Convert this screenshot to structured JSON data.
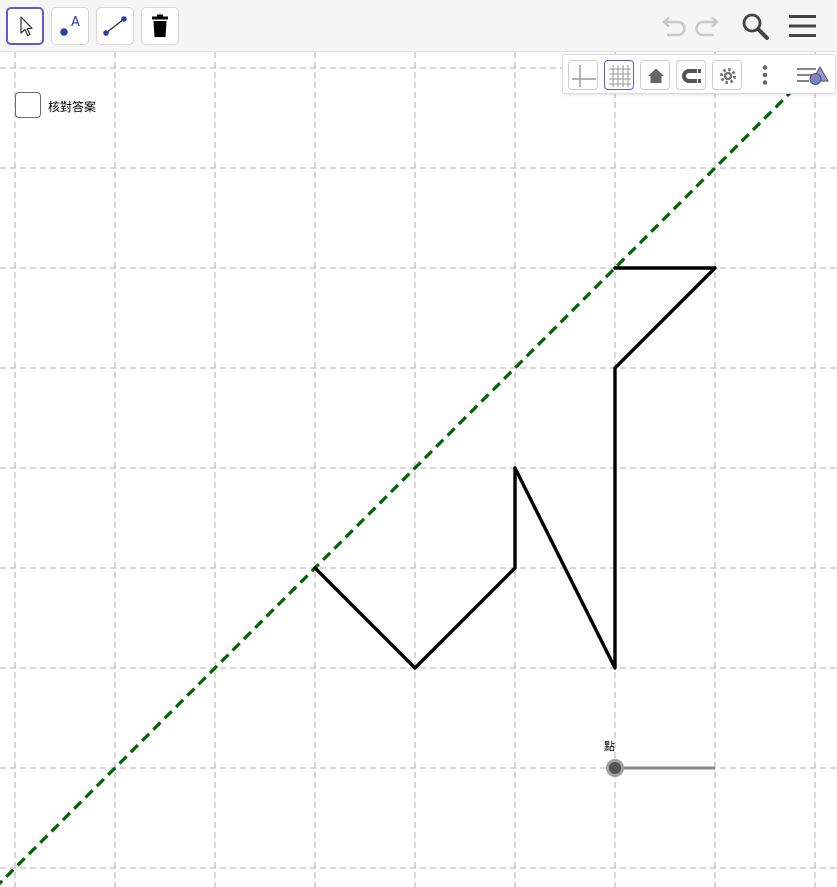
{
  "toolbar": {
    "tools": [
      {
        "name": "move-tool",
        "selected": true
      },
      {
        "name": "point-tool",
        "glyph": "A"
      },
      {
        "name": "segment-tool"
      },
      {
        "name": "delete-tool"
      }
    ],
    "right_controls": [
      "undo-icon",
      "redo-icon",
      "search-icon",
      "menu-icon"
    ]
  },
  "style_bar": {
    "buttons": [
      "axes-toggle",
      "grid-toggle",
      "standard-view-home",
      "point-capturing-magnet",
      "graphics-settings-gear",
      "more-options",
      "toggle-style-bar"
    ]
  },
  "checkbox": {
    "label": "核對答案",
    "checked": false
  },
  "slider": {
    "label": "點"
  },
  "colors": {
    "accent": "#6557d2",
    "grid": "#c0c0c0",
    "dashed_line": "#006400",
    "polyline": "#000000",
    "toolbar_bg": "#f5f5f5"
  }
}
